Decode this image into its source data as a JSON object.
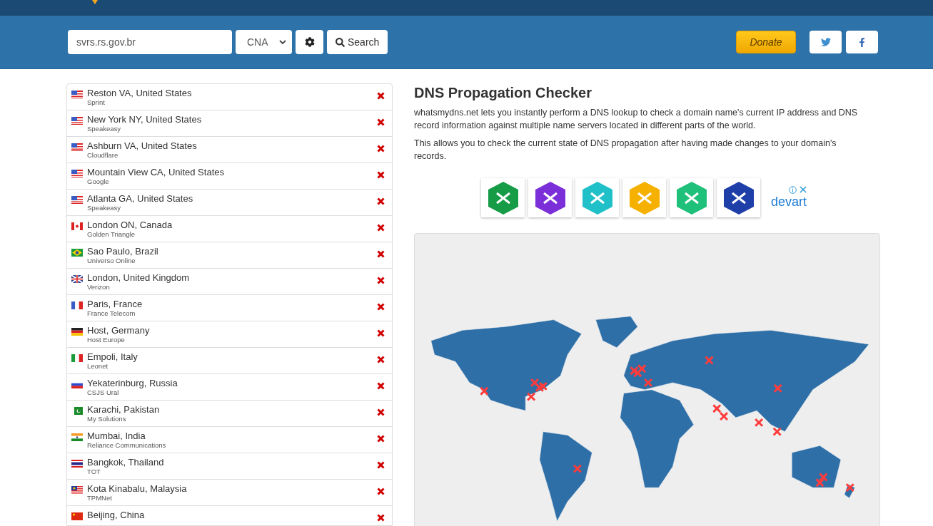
{
  "search": {
    "value": "svrs.rs.gov.br",
    "record_type": "CNA",
    "search_button": "Search"
  },
  "donate_button": "Donate",
  "servers": [
    {
      "location": "Reston VA, United States",
      "provider": "Sprint",
      "failed": true
    },
    {
      "location": "New York NY, United States",
      "provider": "Speakeasy",
      "failed": true
    },
    {
      "location": "Ashburn VA, United States",
      "provider": "Cloudflare",
      "failed": true
    },
    {
      "location": "Mountain View CA, United States",
      "provider": "Google",
      "failed": true
    },
    {
      "location": "Atlanta GA, United States",
      "provider": "Speakeasy",
      "failed": true
    },
    {
      "location": "London ON, Canada",
      "provider": "Golden Triangle",
      "failed": true
    },
    {
      "location": "Sao Paulo, Brazil",
      "provider": "Universo Online",
      "failed": true
    },
    {
      "location": "London, United Kingdom",
      "provider": "Verizon",
      "failed": true
    },
    {
      "location": "Paris, France",
      "provider": "France Telecom",
      "failed": true
    },
    {
      "location": "Host, Germany",
      "provider": "Host Europe",
      "failed": true
    },
    {
      "location": "Empoli, Italy",
      "provider": "Leonet",
      "failed": true
    },
    {
      "location": "Yekaterinburg, Russia",
      "provider": "CSJS Ural",
      "failed": true
    },
    {
      "location": "Karachi, Pakistan",
      "provider": "My Solutions",
      "failed": true
    },
    {
      "location": "Mumbai, India",
      "provider": "Reliance Communications",
      "failed": true
    },
    {
      "location": "Bangkok, Thailand",
      "provider": "TOT",
      "failed": true
    },
    {
      "location": "Kota Kinabalu, Malaysia",
      "provider": "TPMNet",
      "failed": true
    },
    {
      "location": "Beijing, China",
      "failed": true
    }
  ],
  "heading": "DNS Propagation Checker",
  "paragraphs": [
    "whatsmydns.net lets you instantly perform a DNS lookup to check a domain name's current IP address and DNS record information against multiple name servers located in different parts of the world.",
    "This allows you to check the current state of DNS propagation after having made changes to your domain's records."
  ],
  "ad": {
    "brand": "devart"
  }
}
